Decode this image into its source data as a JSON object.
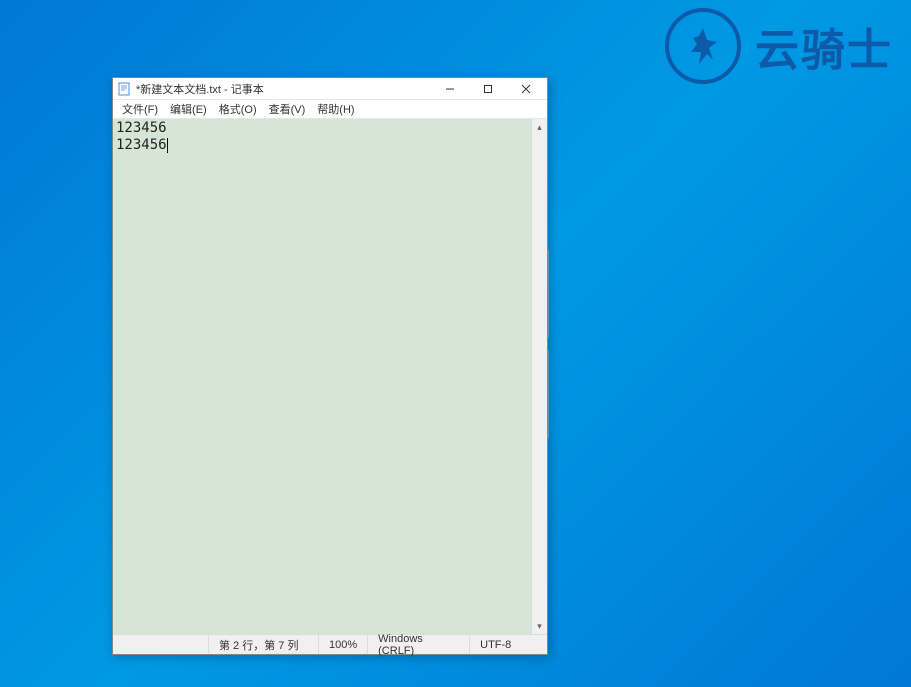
{
  "watermark": {
    "text": "云骑士"
  },
  "window": {
    "title": "*新建文本文档.txt - 记事本"
  },
  "menu": {
    "file": "文件(F)",
    "edit": "编辑(E)",
    "format": "格式(O)",
    "view": "查看(V)",
    "help": "帮助(H)"
  },
  "content": {
    "line1": "123456",
    "line2": "123456"
  },
  "status": {
    "position": "第 2 行，第 7 列",
    "zoom": "100%",
    "line_ending": "Windows (CRLF)",
    "encoding": "UTF-8"
  }
}
